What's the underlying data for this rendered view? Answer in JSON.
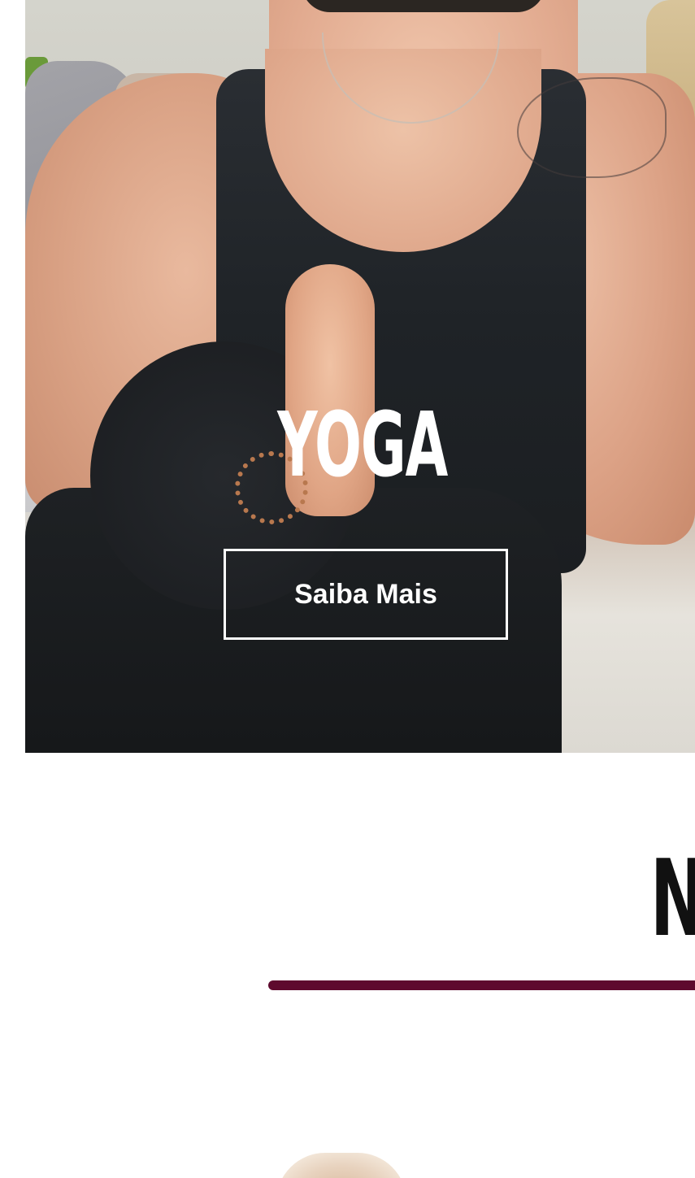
{
  "hero": {
    "title": "YOGA",
    "button_label": "Saiba Mais",
    "image": "woman-yoga-pose-photo"
  },
  "next_section": {
    "heading": "N",
    "divider_color": "#5e0a2e",
    "image": "next-section-photo-top-edge"
  },
  "colors": {
    "accent": "#5e0a2e",
    "hero_text": "#ffffff",
    "heading_text": "#111111"
  }
}
